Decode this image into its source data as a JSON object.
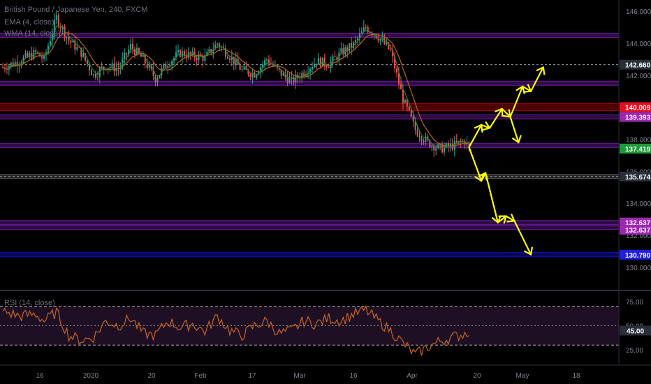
{
  "legend": {
    "symbol_line": "British Pound / Japanese Yen, 240, FXCM",
    "ema_label": "EMA (4, close)",
    "wma_label": "WMA (14, close)",
    "rsi_label": "RSI (14, close)"
  },
  "colors": {
    "background": "#000000",
    "candle_up": "#26a69a",
    "candle_down": "#ef5350",
    "ema": "#2e7d32",
    "wma": "#b5651d",
    "rsi_line": "#c8641e",
    "rsi_band": "#1e0f24",
    "arrows": "#ffff00",
    "zone_purple": "#7b1fa2",
    "zone_red": "#8b0000",
    "zone_blue": "#1010c0"
  },
  "chart_data": {
    "type": "candlestick",
    "symbol": "British Pound / Japanese Yen",
    "timeframe": "240",
    "source": "FXCM",
    "indicators": [
      "EMA (4, close)",
      "WMA (14, close)"
    ],
    "price_axis": {
      "ticks": [
        "146.000",
        "144.000",
        "142.000",
        "138.000",
        "136.000",
        "134.000",
        "132.000",
        "130.000"
      ],
      "ylim": [
        128.6,
        146.7
      ]
    },
    "time_axis": {
      "ticks": [
        "16",
        "2020",
        "20",
        "Feb",
        "17",
        "Mar",
        "16",
        "Apr",
        "20",
        "May",
        "18"
      ]
    },
    "price_series_approx": [
      [
        0,
        142.5
      ],
      [
        4,
        142.9
      ],
      [
        8,
        143.4
      ],
      [
        10,
        143.0
      ],
      [
        13,
        145.6
      ],
      [
        16,
        144.2
      ],
      [
        19,
        143.4
      ],
      [
        22,
        142.0
      ],
      [
        25,
        142.6
      ],
      [
        28,
        142.4
      ],
      [
        31,
        143.8
      ],
      [
        34,
        143.0
      ],
      [
        37,
        141.8
      ],
      [
        40,
        142.8
      ],
      [
        43,
        143.4
      ],
      [
        46,
        143.2
      ],
      [
        49,
        143.1
      ],
      [
        52,
        144.0
      ],
      [
        55,
        143.2
      ],
      [
        58,
        142.3
      ],
      [
        61,
        142.1
      ],
      [
        64,
        143.0
      ],
      [
        67,
        142.2
      ],
      [
        70,
        141.6
      ],
      [
        73,
        142.2
      ],
      [
        76,
        142.9
      ],
      [
        79,
        142.7
      ],
      [
        82,
        143.4
      ],
      [
        85,
        143.9
      ],
      [
        88,
        145.0
      ],
      [
        91,
        144.4
      ],
      [
        94,
        143.5
      ],
      [
        97,
        140.5
      ],
      [
        100,
        138.6
      ],
      [
        103,
        137.8
      ],
      [
        106,
        137.4
      ],
      [
        109,
        137.6
      ],
      [
        112,
        137.9
      ],
      [
        113,
        137.5
      ]
    ],
    "price_tags": [
      {
        "value": "142.660",
        "color": "#2a2e39"
      },
      {
        "value": "140.009",
        "color": "#e5101f"
      },
      {
        "value": "139.393",
        "color": "#9c27b0"
      },
      {
        "value": "137.419",
        "color": "#1e9a3a"
      },
      {
        "value": "135.674",
        "color": "#2a2e39"
      },
      {
        "value": "132.637",
        "color": "#9c27b0"
      },
      {
        "value": "132.637",
        "color": "#9c27b0"
      },
      {
        "value": "130.790",
        "color": "#1f1fdd"
      }
    ],
    "zones": [
      {
        "price": 144.5,
        "color": "#6a1b9a"
      },
      {
        "price": 141.5,
        "color": "#6a1b9a"
      },
      {
        "price": 140.009,
        "color": "#b00000"
      },
      {
        "price": 139.393,
        "color": "#6a1b9a"
      },
      {
        "price": 137.6,
        "color": "#6a1b9a"
      },
      {
        "price": 135.674,
        "color": "#555555"
      },
      {
        "price": 132.8,
        "color": "#6a1b9a"
      },
      {
        "price": 132.5,
        "color": "#6a1b9a"
      },
      {
        "price": 130.79,
        "color": "#1010c0"
      }
    ],
    "projection_paths": [
      [
        [
          113,
          137.5
        ],
        [
          116,
          138.9
        ],
        [
          118,
          138.7
        ],
        [
          121,
          139.9
        ],
        [
          123,
          139.4
        ],
        [
          126,
          141.3
        ],
        [
          128,
          141.0
        ],
        [
          131,
          142.5
        ]
      ],
      [
        [
          123,
          139.4
        ],
        [
          125,
          137.8
        ]
      ],
      [
        [
          113,
          137.5
        ],
        [
          116,
          135.4
        ],
        [
          117,
          135.9
        ],
        [
          120,
          132.8
        ],
        [
          122,
          133.2
        ],
        [
          124,
          132.9
        ],
        [
          128,
          130.8
        ]
      ]
    ],
    "rsi": {
      "label": "RSI (14, close)",
      "ticks": [
        "75.00",
        "50.00",
        "25.00"
      ],
      "levels": [
        70,
        30
      ],
      "current_tag": "45.00",
      "ylim": [
        10,
        85
      ],
      "values_approx": [
        [
          0,
          65
        ],
        [
          4,
          60
        ],
        [
          8,
          62
        ],
        [
          10,
          55
        ],
        [
          13,
          64
        ],
        [
          16,
          40
        ],
        [
          19,
          35
        ],
        [
          22,
          38
        ],
        [
          25,
          55
        ],
        [
          28,
          50
        ],
        [
          31,
          58
        ],
        [
          34,
          42
        ],
        [
          37,
          40
        ],
        [
          40,
          55
        ],
        [
          43,
          48
        ],
        [
          46,
          52
        ],
        [
          49,
          44
        ],
        [
          52,
          60
        ],
        [
          55,
          45
        ],
        [
          58,
          40
        ],
        [
          61,
          50
        ],
        [
          64,
          55
        ],
        [
          67,
          42
        ],
        [
          70,
          45
        ],
        [
          73,
          55
        ],
        [
          76,
          52
        ],
        [
          79,
          58
        ],
        [
          82,
          55
        ],
        [
          85,
          62
        ],
        [
          88,
          66
        ],
        [
          91,
          55
        ],
        [
          94,
          45
        ],
        [
          97,
          32
        ],
        [
          100,
          20
        ],
        [
          103,
          28
        ],
        [
          106,
          34
        ],
        [
          109,
          38
        ],
        [
          112,
          42
        ],
        [
          113,
          45
        ]
      ]
    }
  }
}
